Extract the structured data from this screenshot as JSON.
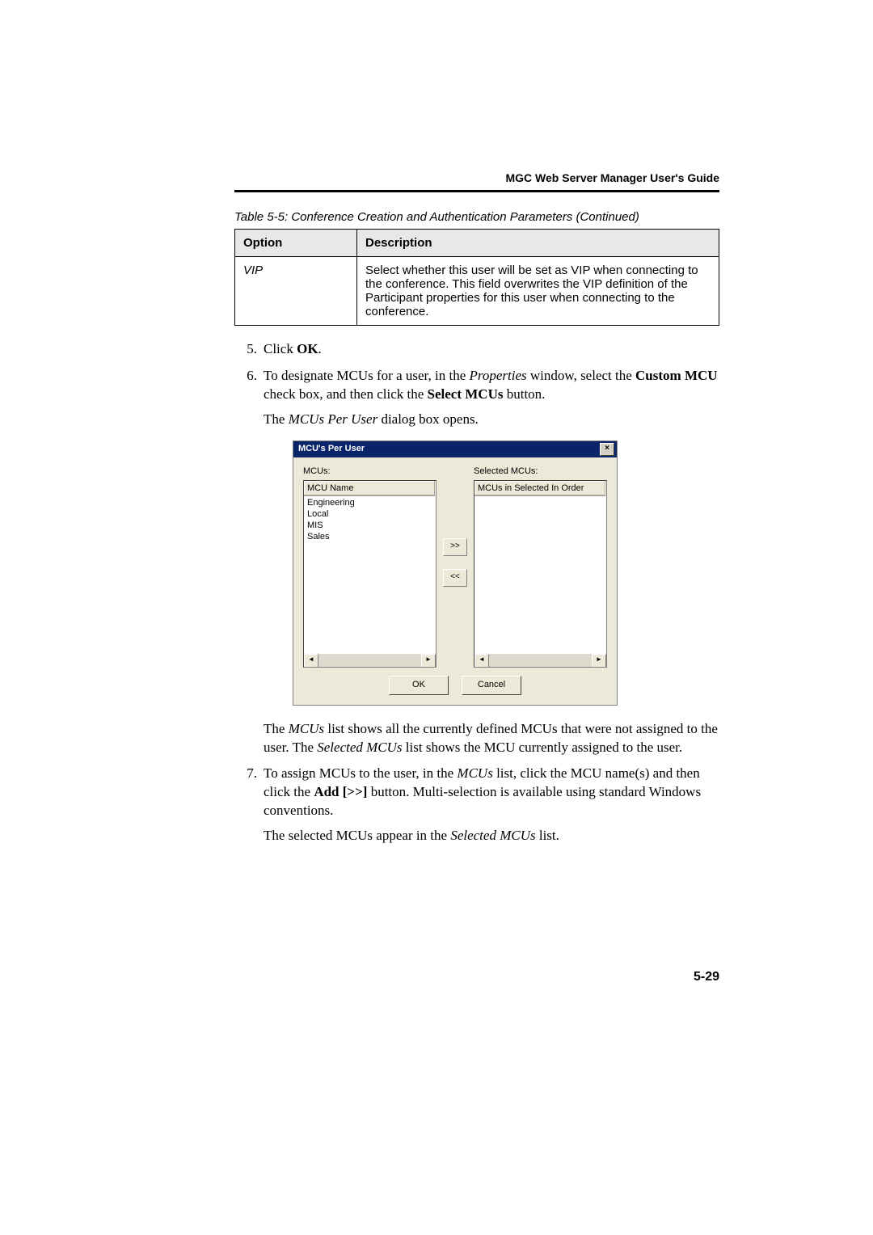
{
  "header": {
    "guide": "MGC Web Server Manager User's Guide"
  },
  "table": {
    "caption": "Table 5-5: Conference Creation and Authentication Parameters (Continued)",
    "head_option": "Option",
    "head_desc": "Description",
    "row": {
      "option": "VIP",
      "desc": "Select whether this user will be set as VIP when connecting to the conference. This field overwrites the VIP definition of the Participant properties for this user when connecting to the conference."
    }
  },
  "steps": {
    "s5": {
      "t1": "Click ",
      "b1": "OK",
      "t2": "."
    },
    "s6": {
      "t1": "To designate MCUs for a user, in the ",
      "i1": "Properties",
      "t2": " window, select the ",
      "b1": "Custom MCU",
      "t3": " check box, and then click the ",
      "b2": "Select MCUs",
      "t4": " button.",
      "sub_t1": "The ",
      "sub_i1": "MCUs Per User",
      "sub_t2": " dialog box opens."
    },
    "s7": {
      "t1": "To assign MCUs to the user, in the ",
      "i1": "MCUs",
      "t2": " list, click the MCU name(s) and then click the ",
      "b1": "Add [>>]",
      "t3": " button. Multi-selection is available using standard Windows conventions.",
      "sub_t1": "The selected MCUs appear in the ",
      "sub_i1": "Selected MCUs",
      "sub_t2": " list."
    }
  },
  "dialog": {
    "title": "MCU's Per User",
    "close": "×",
    "mcus_label": "MCUs:",
    "selected_label": "Selected MCUs:",
    "mcu_head": "MCU Name",
    "selected_head": "MCUs in Selected In Order",
    "items": [
      "Engineering",
      "Local",
      "MIS",
      "Sales"
    ],
    "add": ">>",
    "remove": "<<",
    "scroll_left": "◄",
    "scroll_right": "►",
    "ok": "OK",
    "cancel": "Cancel"
  },
  "para_after": {
    "t1": "The ",
    "i1": "MCUs",
    "t2": " list shows all the currently defined MCUs that were not assigned to the user. The ",
    "i2": "Selected MCUs",
    "t3": " list shows the MCU currently assigned to the user."
  },
  "pagenum": "5-29"
}
